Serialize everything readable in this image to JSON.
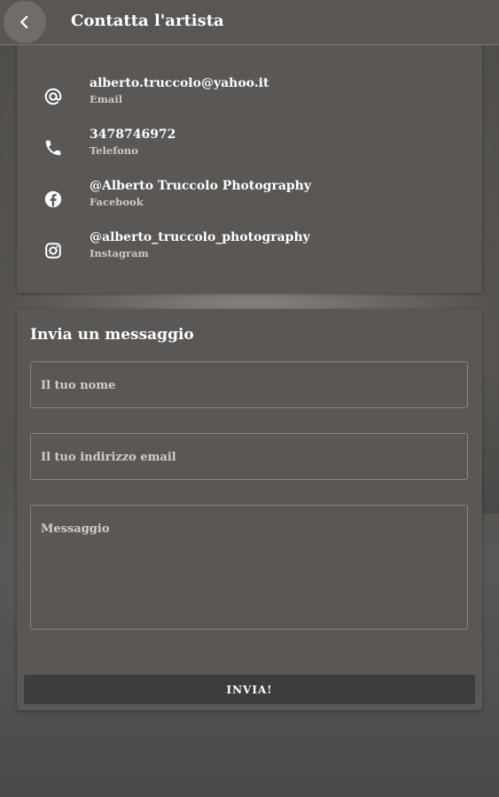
{
  "appbar": {
    "title": "Contatta l'artista",
    "back_icon": "chevron-left-icon"
  },
  "contacts": [
    {
      "value": "alberto.truccolo@yahoo.it",
      "label": "Email",
      "icon": "at-icon"
    },
    {
      "value": "3478746972",
      "label": "Telefono",
      "icon": "phone-icon"
    },
    {
      "value": "@Alberto Truccolo Photography",
      "label": "Facebook",
      "icon": "facebook-icon"
    },
    {
      "value": "@alberto_truccolo_photography",
      "label": "Instagram",
      "icon": "instagram-icon"
    }
  ],
  "message_form": {
    "heading": "Invia un messaggio",
    "name_placeholder": "Il tuo nome",
    "email_placeholder": "Il tuo indirizzo email",
    "message_placeholder": "Messaggio",
    "send_label": "INVIA!"
  },
  "colors": {
    "appbar": "#5a5654",
    "card": "#5a5755",
    "button": "#3f3d3c",
    "text": "#ffffff"
  }
}
